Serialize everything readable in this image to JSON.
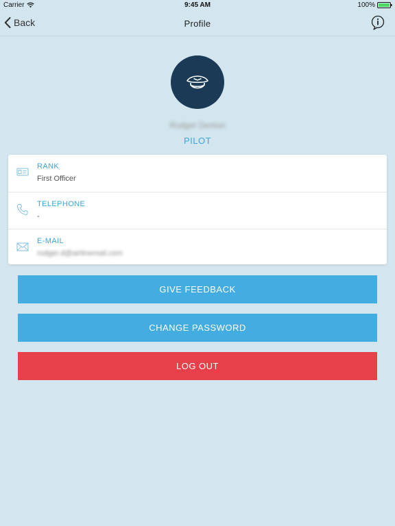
{
  "status_bar": {
    "carrier": "Carrier",
    "time": "9:45 AM",
    "battery": "100%"
  },
  "nav": {
    "back_label": "Back",
    "title": "Profile"
  },
  "profile": {
    "name": "Rodger Denton",
    "role": "PILOT"
  },
  "details": {
    "rank": {
      "label": "RANK",
      "value": "First Officer"
    },
    "telephone": {
      "label": "TELEPHONE",
      "value": "-"
    },
    "email": {
      "label": "E-MAIL",
      "value": "rodger.d@airlinemail.com"
    }
  },
  "actions": {
    "feedback_label": "GIVE FEEDBACK",
    "password_label": "CHANGE PASSWORD",
    "logout_label": "LOG OUT"
  },
  "colors": {
    "background": "#d3e5ee",
    "accent": "#3aa6dc",
    "button_blue": "#43ade2",
    "button_red": "#e8404a",
    "avatar": "#1a3a55"
  }
}
